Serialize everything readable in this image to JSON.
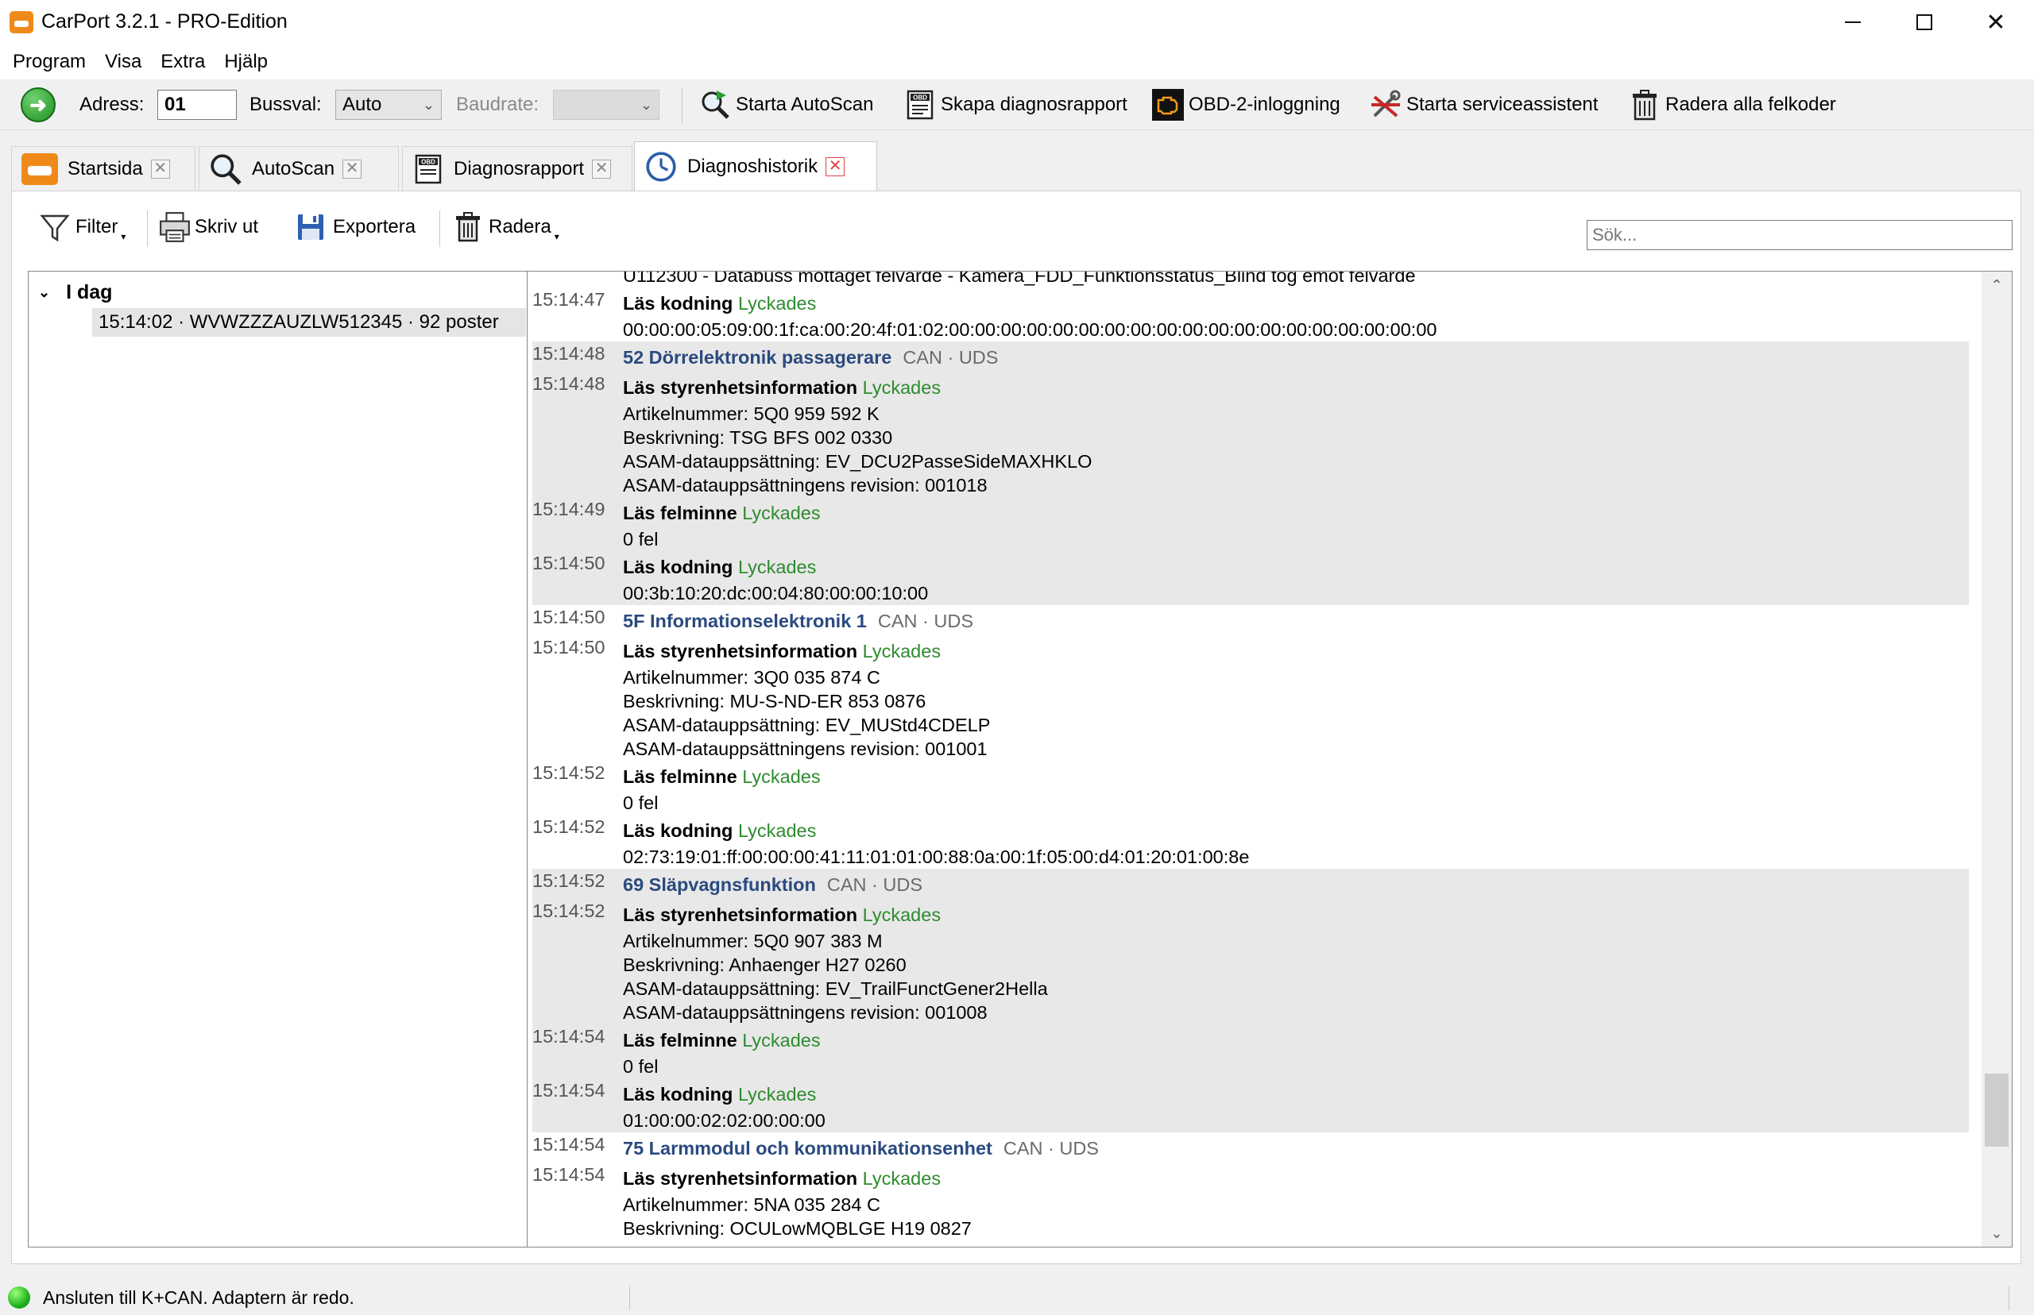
{
  "window": {
    "title": "CarPort 3.2.1 - PRO-Edition"
  },
  "menu": [
    "Program",
    "Visa",
    "Extra",
    "Hjälp"
  ],
  "toolbar": {
    "address_label": "Adress:",
    "address_value": "01",
    "bus_label": "Bussval:",
    "bus_value": "Auto",
    "baud_label": "Baudrate:",
    "baud_value": "",
    "autoscan": "Starta AutoScan",
    "report": "Skapa diagnosrapport",
    "obd2": "OBD-2-inloggning",
    "service": "Starta serviceassistent",
    "clear_codes": "Radera alla felkoder"
  },
  "tabs": [
    {
      "label": "Startsida",
      "close": "✕"
    },
    {
      "label": "AutoScan",
      "close": "✕"
    },
    {
      "label": "Diagnosrapport",
      "close": "✕"
    },
    {
      "label": "Diagnoshistorik",
      "close": "✕"
    }
  ],
  "subtoolbar": {
    "filter": "Filter",
    "print": "Skriv ut",
    "export": "Exportera",
    "delete": "Radera",
    "search_placeholder": "Sök..."
  },
  "tree": {
    "group": "I dag",
    "item": "15:14:02 · WVWZZZAUZLW512345 · 92 poster"
  },
  "log": {
    "top_line": "U112300 - Databuss mottaget felvärde - Kamera_FDD_Funktionsstatus_Blind tog emot felvärde",
    "entries": [
      {
        "ts": "15:14:47",
        "op": "Läs kodning",
        "status": "Lyckades",
        "lines": [
          "00:00:00:05:09:00:1f:ca:00:20:4f:01:02:00:00:00:00:00:00:00:00:00:00:00:00:00:00:00:00:00:00:00"
        ]
      },
      {
        "ts": "15:14:48",
        "module": "52 Dörrelektronik passagerare",
        "proto": "CAN · UDS"
      },
      {
        "ts": "15:14:48",
        "op": "Läs styrenhetsinformation",
        "status": "Lyckades",
        "lines": [
          "Artikelnummer: 5Q0 959 592 K",
          "Beskrivning: TSG BFS 002 0330",
          "ASAM-datauppsättning: EV_DCU2PasseSideMAXHKLO",
          "ASAM-datauppsättningens revision: 001018"
        ]
      },
      {
        "ts": "15:14:49",
        "op": "Läs felminne",
        "status": "Lyckades",
        "lines": [
          "0 fel"
        ]
      },
      {
        "ts": "15:14:50",
        "op": "Läs kodning",
        "status": "Lyckades",
        "lines": [
          "00:3b:10:20:dc:00:04:80:00:00:10:00"
        ]
      },
      {
        "ts": "15:14:50",
        "module": "5F Informationselektronik 1",
        "proto": "CAN · UDS"
      },
      {
        "ts": "15:14:50",
        "op": "Läs styrenhetsinformation",
        "status": "Lyckades",
        "lines": [
          "Artikelnummer: 3Q0 035 874 C",
          "Beskrivning: MU-S-ND-ER 853 0876",
          "ASAM-datauppsättning: EV_MUStd4CDELP",
          "ASAM-datauppsättningens revision: 001001"
        ]
      },
      {
        "ts": "15:14:52",
        "op": "Läs felminne",
        "status": "Lyckades",
        "lines": [
          "0 fel"
        ]
      },
      {
        "ts": "15:14:52",
        "op": "Läs kodning",
        "status": "Lyckades",
        "lines": [
          "02:73:19:01:ff:00:00:00:41:11:01:01:00:88:0a:00:1f:05:00:d4:01:20:01:00:8e"
        ]
      },
      {
        "ts": "15:14:52",
        "module": "69 Släpvagnsfunktion",
        "proto": "CAN · UDS"
      },
      {
        "ts": "15:14:52",
        "op": "Läs styrenhetsinformation",
        "status": "Lyckades",
        "lines": [
          "Artikelnummer: 5Q0 907 383 M",
          "Beskrivning: Anhaenger H27 0260",
          "ASAM-datauppsättning: EV_TrailFunctGener2Hella",
          "ASAM-datauppsättningens revision: 001008"
        ]
      },
      {
        "ts": "15:14:54",
        "op": "Läs felminne",
        "status": "Lyckades",
        "lines": [
          "0 fel"
        ]
      },
      {
        "ts": "15:14:54",
        "op": "Läs kodning",
        "status": "Lyckades",
        "lines": [
          "01:00:00:02:02:00:00:00"
        ]
      },
      {
        "ts": "15:14:54",
        "module": "75 Larmmodul och kommunikationsenhet",
        "proto": "CAN · UDS"
      },
      {
        "ts": "15:14:54",
        "op": "Läs styrenhetsinformation",
        "status": "Lyckades",
        "lines": [
          "Artikelnummer: 5NA 035 284 C",
          "Beskrivning: OCULowMQBLGE H19 0827"
        ]
      }
    ]
  },
  "status": {
    "text": "Ansluten till K+CAN. Adaptern är redo."
  }
}
